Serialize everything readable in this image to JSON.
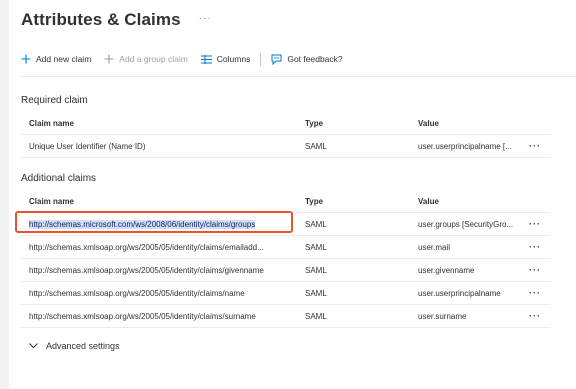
{
  "page": {
    "title": "Attributes & Claims",
    "title_more": "···"
  },
  "toolbar": {
    "add_new_claim": "Add new claim",
    "add_group_claim": "Add a group claim",
    "columns": "Columns",
    "feedback": "Got feedback?"
  },
  "required": {
    "heading": "Required claim",
    "columns": {
      "name": "Claim name",
      "type": "Type",
      "value": "Value"
    },
    "rows": [
      {
        "name": "Unique User Identifier (Name ID)",
        "type": "SAML",
        "value": "user.userprincipalname [...",
        "more": "···"
      }
    ]
  },
  "additional": {
    "heading": "Additional claims",
    "columns": {
      "name": "Claim name",
      "type": "Type",
      "value": "Value"
    },
    "rows": [
      {
        "name": "http://schemas.microsoft.com/ws/2008/06/identity/claims/groups",
        "type": "SAML",
        "value": "user.groups [SecurityGro...",
        "more": "···"
      },
      {
        "name": "http://schemas.xmlsoap.org/ws/2005/05/identity/claims/emailadd...",
        "type": "SAML",
        "value": "user.mail",
        "more": "···"
      },
      {
        "name": "http://schemas.xmlsoap.org/ws/2005/05/identity/claims/givenname",
        "type": "SAML",
        "value": "user.givenname",
        "more": "···"
      },
      {
        "name": "http://schemas.xmlsoap.org/ws/2005/05/identity/claims/name",
        "type": "SAML",
        "value": "user.userprincipalname",
        "more": "···"
      },
      {
        "name": "http://schemas.xmlsoap.org/ws/2005/05/identity/claims/surname",
        "type": "SAML",
        "value": "user.surname",
        "more": "···"
      }
    ]
  },
  "advanced_settings": "Advanced settings",
  "colors": {
    "accent": "#0078d4",
    "highlight_border": "#e8542f",
    "selection": "#cfe0f5"
  },
  "icons": [
    "plus-icon",
    "columns-icon",
    "feedback-icon",
    "chevron-down-icon"
  ]
}
